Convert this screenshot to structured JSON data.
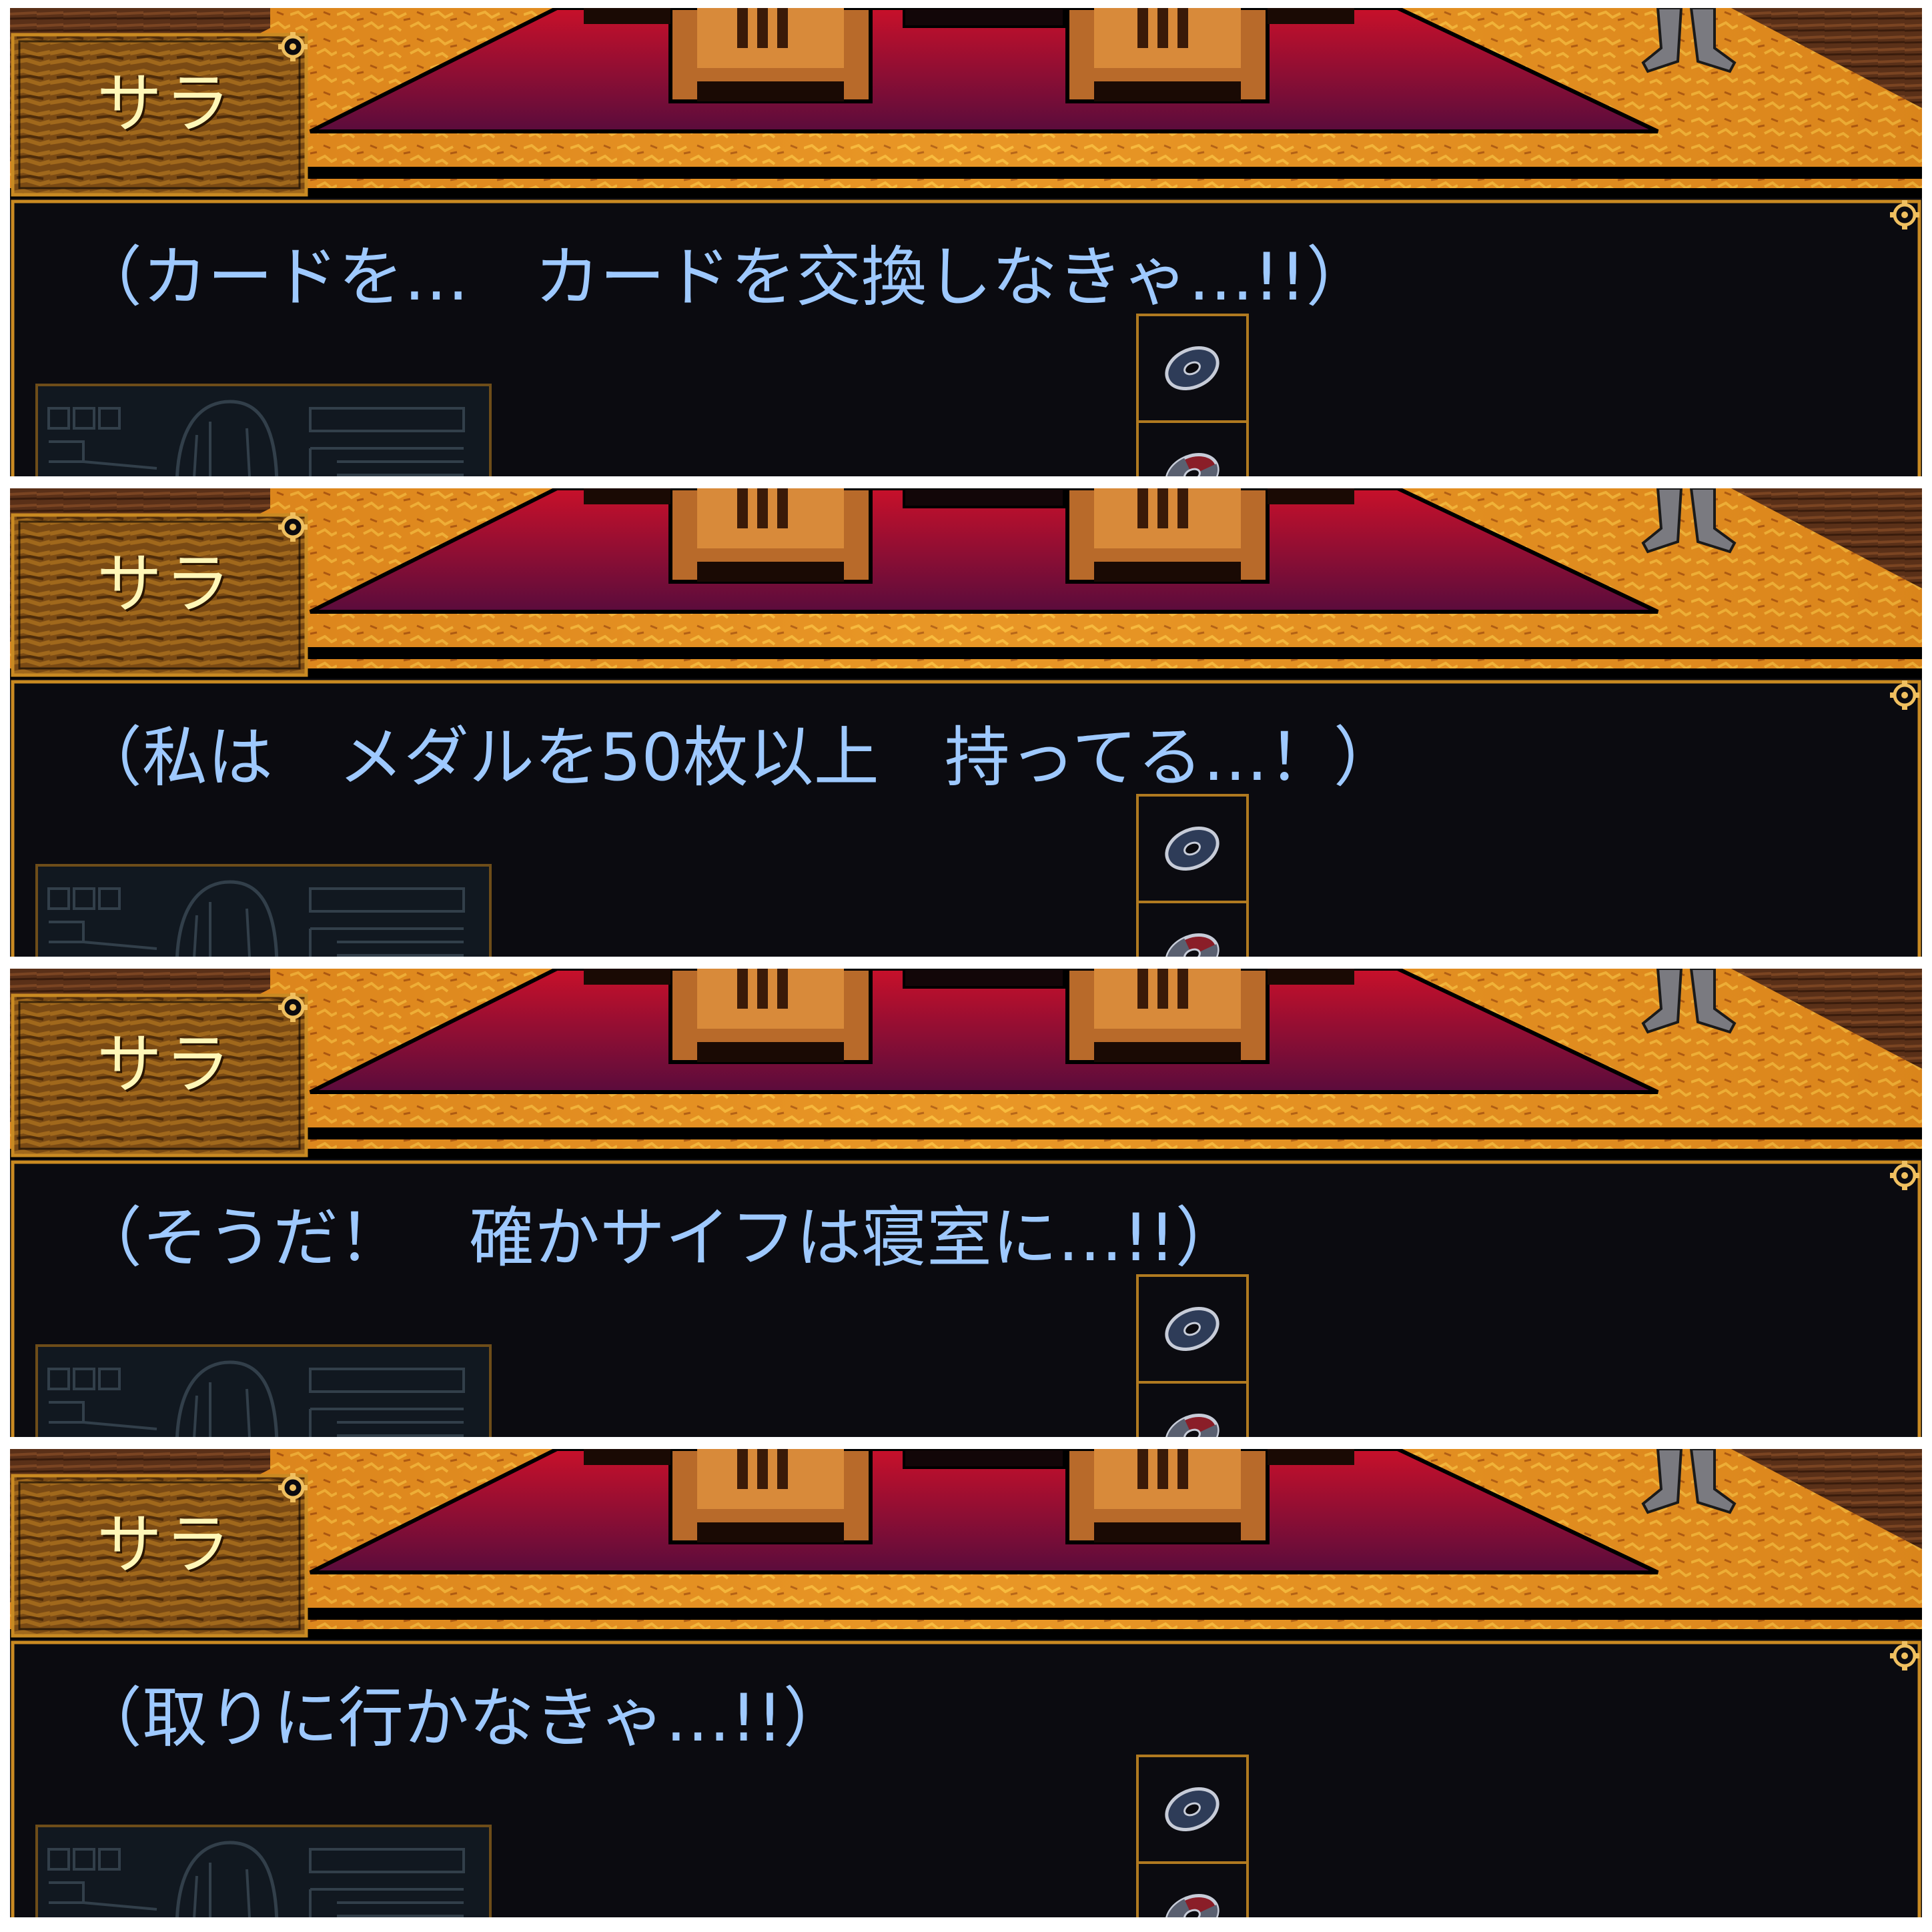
{
  "panels": [
    {
      "speaker": "サラ",
      "text": "（カードを…　カードを交換しなきゃ…!!）"
    },
    {
      "speaker": "サラ",
      "text": "（私は　メダルを50枚以上　持ってる…！）"
    },
    {
      "speaker": "サラ",
      "text": "（そうだ！　確かサイフは寝室に…!!）"
    },
    {
      "speaker": "サラ",
      "text": "（取りに行かなきゃ…!!）"
    }
  ],
  "colors": {
    "floor": "#e08a1c",
    "carpet_top": "#c8102a",
    "carpet_bottom": "#5a0c3c",
    "frame": "#c98a22",
    "dialogue_text": "#9ec9ff",
    "speaker_text": "#fff7b8"
  },
  "icons": [
    "settings-gear-icon",
    "disc-icon",
    "red-disc-icon",
    "character-card-icon"
  ]
}
